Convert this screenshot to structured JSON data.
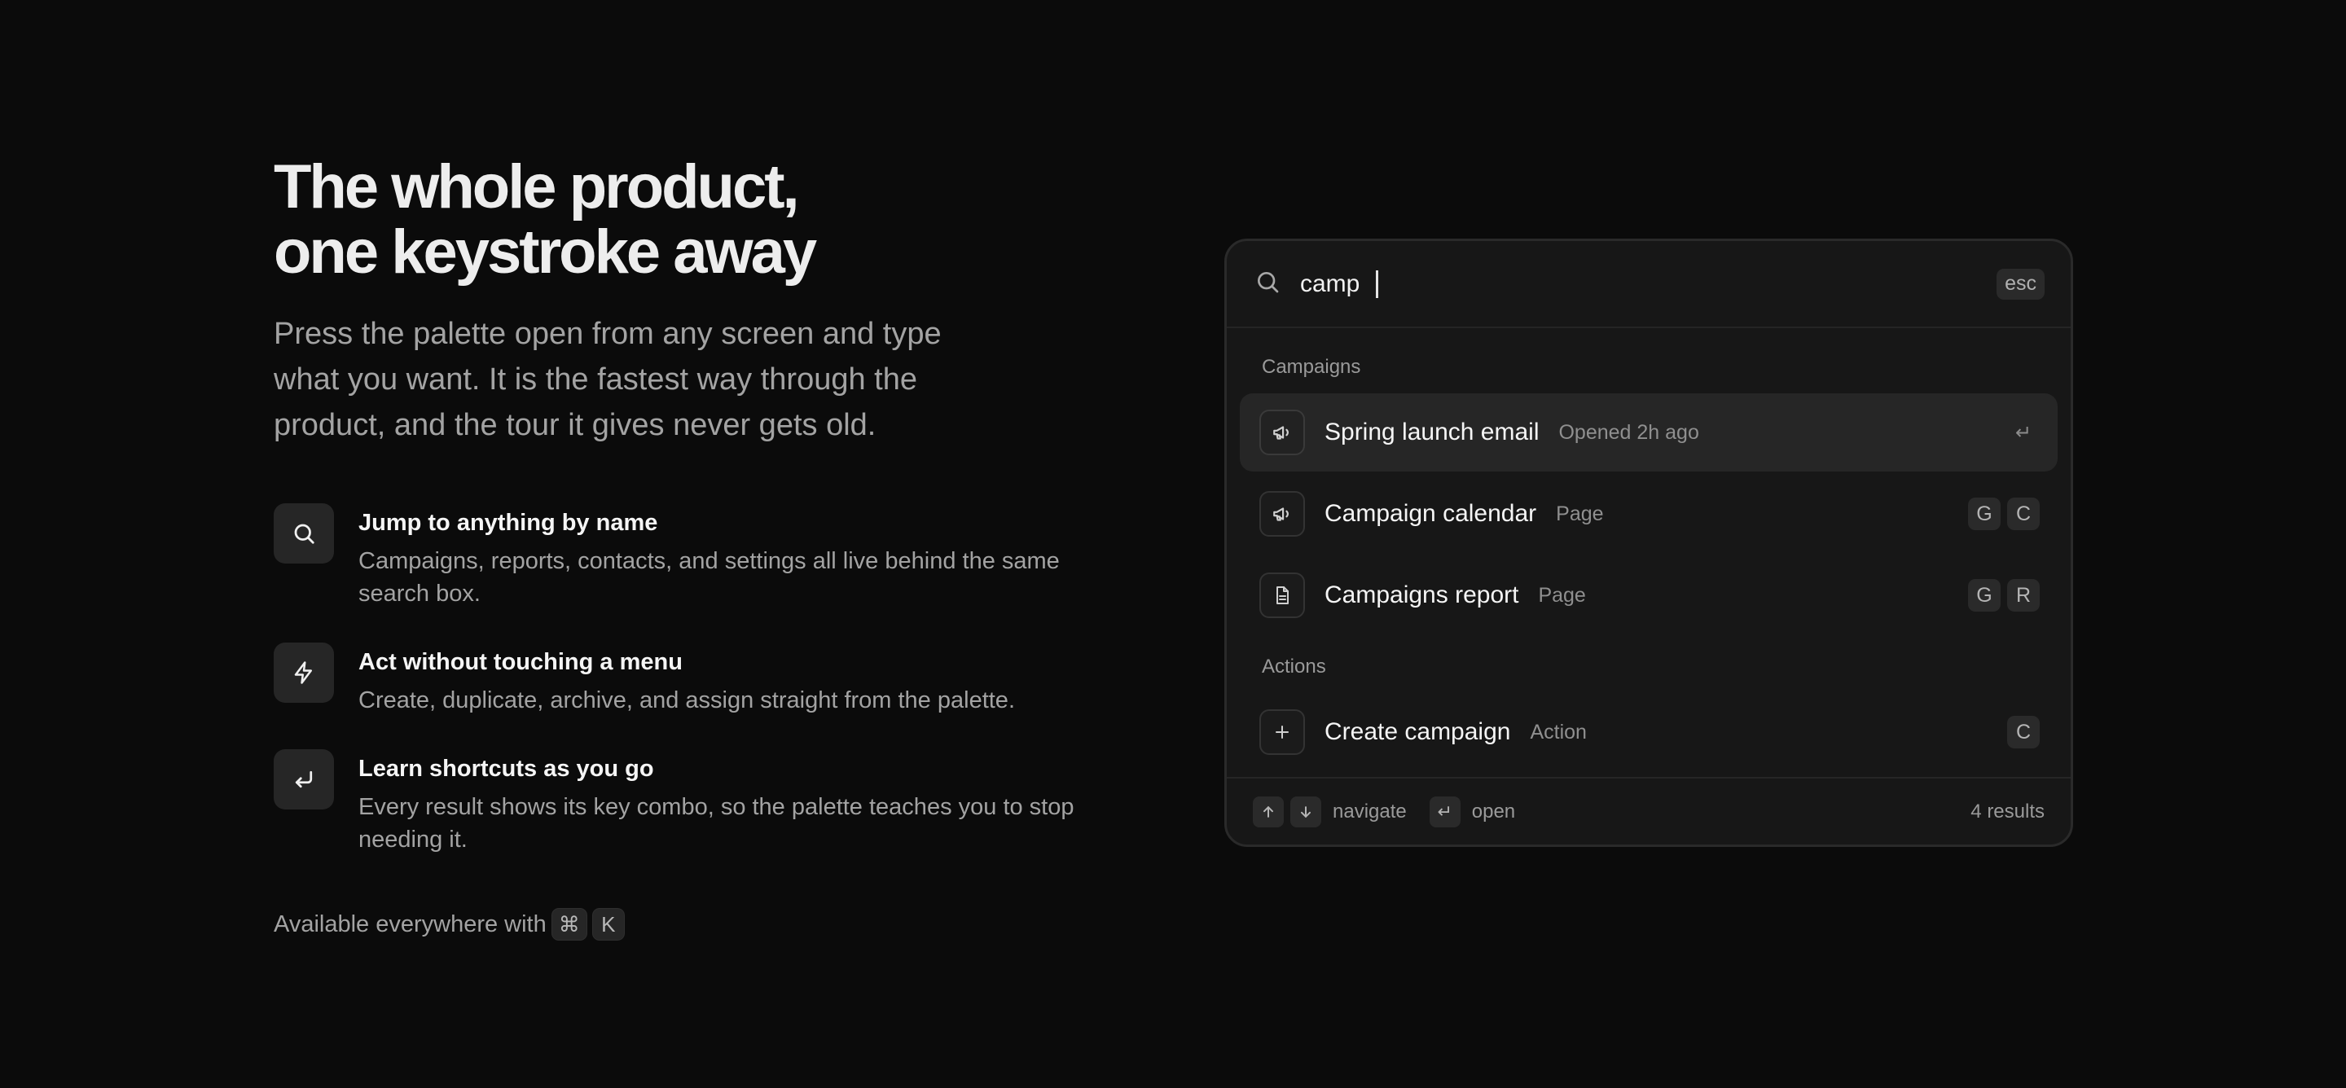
{
  "hero": {
    "title_line1": "The whole product,",
    "title_line2": "one keystroke away",
    "lead": "Press the palette open from any screen and type what you want. It is the fastest way through the product, and the tour it gives never gets old."
  },
  "features": [
    {
      "icon": "search-icon",
      "title": "Jump to anything by name",
      "desc": "Campaigns, reports, contacts, and settings all live behind the same search box."
    },
    {
      "icon": "lightning-icon",
      "title": "Act without touching a menu",
      "desc": "Create, duplicate, archive, and assign straight from the palette."
    },
    {
      "icon": "enter-icon",
      "title": "Learn shortcuts as you go",
      "desc": "Every result shows its key combo, so the palette teaches you to stop needing it."
    }
  ],
  "availability": {
    "text": "Available everywhere with",
    "keys": [
      "⌘",
      "K"
    ]
  },
  "palette": {
    "query": "camp",
    "esc_label": "esc",
    "groups": [
      {
        "label": "Campaigns",
        "items": [
          {
            "icon": "megaphone-icon",
            "title": "Spring launch email",
            "meta": "Opened 2h ago",
            "keys": [
              "↵"
            ],
            "active": true
          },
          {
            "icon": "megaphone-icon",
            "title": "Campaign calendar",
            "meta": "Page",
            "keys": [
              "G",
              "C"
            ]
          },
          {
            "icon": "document-icon",
            "title": "Campaigns report",
            "meta": "Page",
            "keys": [
              "G",
              "R"
            ]
          }
        ]
      },
      {
        "label": "Actions",
        "items": [
          {
            "icon": "plus-icon",
            "title": "Create campaign",
            "meta": "Action",
            "keys": [
              "C"
            ]
          }
        ]
      }
    ],
    "footer": {
      "navigate_label": "navigate",
      "open_key": "↵",
      "open_label": "open",
      "results_count": "4 results"
    }
  },
  "colors": {
    "background": "#0b0b0b",
    "panel": "#171717",
    "active_row": "#262626",
    "muted_text": "#a3a3a3"
  }
}
